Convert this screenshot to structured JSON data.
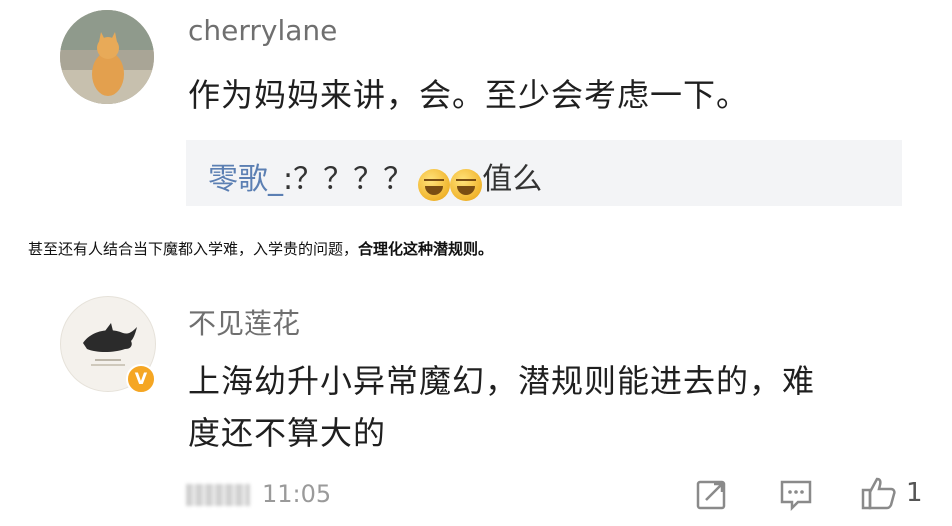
{
  "comment1": {
    "username": "cherrylane",
    "text": "作为妈妈来讲，会。至少会考虑一下。",
    "reply": {
      "user": "零歌_",
      "text_prefix": ":？？？？",
      "text_suffix": "值么",
      "emojis": [
        "grin-squint-emoji",
        "grin-squint-emoji"
      ]
    }
  },
  "caption": {
    "normal": "甚至还有人结合当下魔都入学难，入学贵的问题，",
    "bold": "合理化这种潜规则。"
  },
  "comment2": {
    "username": "不见莲花",
    "verified_badge": "V",
    "text_line1": "上海幼升小异常魔幻，潜规则能进去的，难",
    "text_line2": "度还不算大的",
    "time": "11:05",
    "like_count": "1"
  },
  "icons": {
    "share": "share-icon",
    "comment": "comment-icon",
    "like": "thumbs-up-icon"
  },
  "colors": {
    "reply_user": "#5b7fb3",
    "badge": "#f5a623",
    "reply_bg": "#f3f4f6"
  }
}
